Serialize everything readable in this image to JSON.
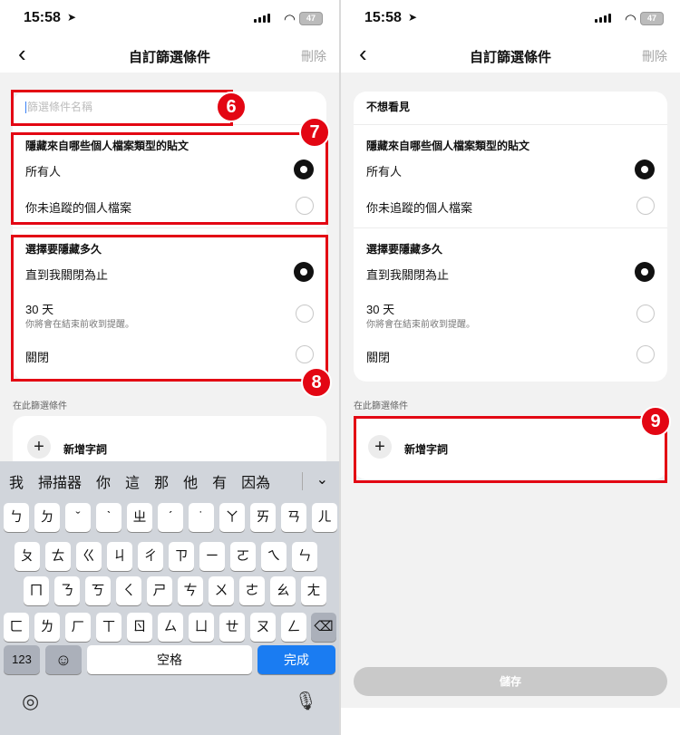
{
  "status": {
    "time": "15:58",
    "battery": "47"
  },
  "nav": {
    "title": "自訂篩選條件",
    "delete": "刪除"
  },
  "filter": {
    "name_placeholder": "篩選條件名稱",
    "name_value": "不想看見",
    "profile_section": "隱藏來自哪些個人檔案類型的貼文",
    "profile_options": [
      "所有人",
      "你未追蹤的個人檔案"
    ],
    "duration_section": "選擇要隱藏多久",
    "duration_options": [
      "直到我關閉為止",
      "30 天",
      "關閉"
    ],
    "duration_sub": "你將會在結束前收到提醒。",
    "words_label": "在此篩選條件",
    "add_word": "新增字詞",
    "save": "儲存"
  },
  "badges": [
    "6",
    "7",
    "8",
    "9"
  ],
  "keyboard": {
    "candidates": [
      "我",
      "掃描器",
      "你",
      "這",
      "那",
      "他",
      "有",
      "因為"
    ],
    "row1": [
      "ㄅ",
      "ㄉ",
      "ˇ",
      "ˋ",
      "ㄓ",
      "ˊ",
      "˙",
      "ㄚ",
      "ㄞ",
      "ㄢ",
      "ㄦ"
    ],
    "row2": [
      "ㄆ",
      "ㄊ",
      "ㄍ",
      "ㄐ",
      "ㄔ",
      "ㄗ",
      "ㄧ",
      "ㄛ",
      "ㄟ",
      "ㄣ"
    ],
    "row3": [
      "ㄇ",
      "ㄋ",
      "ㄎ",
      "ㄑ",
      "ㄕ",
      "ㄘ",
      "ㄨ",
      "ㄜ",
      "ㄠ",
      "ㄤ"
    ],
    "row4": [
      "ㄈ",
      "ㄌ",
      "ㄏ",
      "ㄒ",
      "ㄖ",
      "ㄙ",
      "ㄩ",
      "ㄝ",
      "ㄡ",
      "ㄥ"
    ],
    "num_key": "123",
    "space": "空格",
    "done": "完成",
    "emoji": "☺",
    "delete_glyph": "⌫"
  },
  "colors": {
    "highlight": "#e30613",
    "done_button": "#1a7cf2",
    "save_disabled": "#c9c9c9"
  }
}
